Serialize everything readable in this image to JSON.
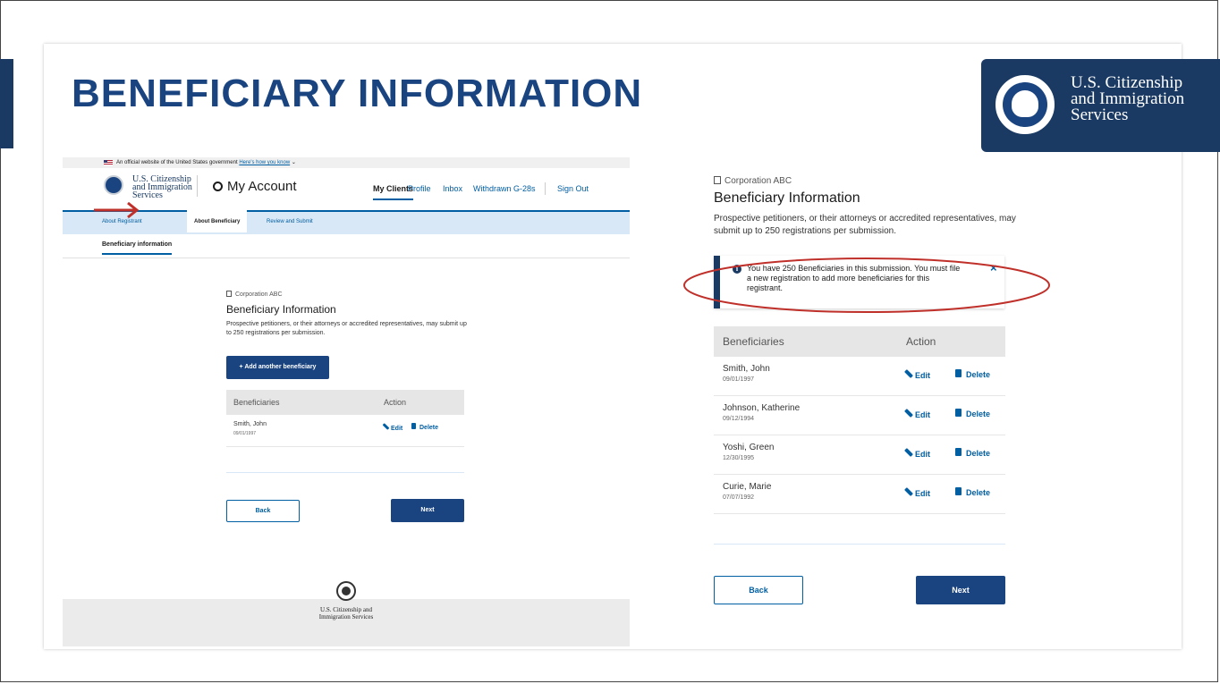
{
  "slide": {
    "title": "BENEFICIARY INFORMATION",
    "logo_lines": [
      "U.S. Citizenship",
      "and Immigration",
      "Services"
    ]
  },
  "left": {
    "gov_banner": "An official website of the United States government",
    "gov_banner_link": "Here's how you know",
    "header_logo_lines": [
      "U.S. Citizenship",
      "and Immigration",
      "Services"
    ],
    "my_account": "My Account",
    "nav": [
      "My Clients",
      "Profile",
      "Inbox",
      "Withdrawn G-28s",
      "Sign Out"
    ],
    "tabs": [
      "About Registrant",
      "About Beneficiary",
      "Review and Submit"
    ],
    "section_link": "Beneficiary information",
    "company": "Corporation ABC",
    "heading": "Beneficiary Information",
    "description": "Prospective petitioners, or their attorneys or accredited representatives, may submit up to 250 registrations per submission.",
    "add_button": "+ Add another beneficiary",
    "table": {
      "headers": [
        "Beneficiaries",
        "Action"
      ],
      "rows": [
        {
          "name": "Smith, John",
          "dob": "09/01/1997"
        }
      ]
    },
    "edit_label": "Edit",
    "delete_label": "Delete",
    "back": "Back",
    "next": "Next",
    "footer_lines": [
      "U.S. Citizenship and",
      "Immigration Services"
    ]
  },
  "right": {
    "company": "Corporation ABC",
    "heading": "Beneficiary Information",
    "description": "Prospective petitioners, or their attorneys or accredited representatives, may submit up to 250 registrations per submission.",
    "alert": "You have 250 Beneficiaries in this submission. You must file a new registration to add more beneficiaries for this registrant.",
    "alert_close": "×",
    "table": {
      "headers": [
        "Beneficiaries",
        "Action"
      ],
      "rows": [
        {
          "name": "Smith, John",
          "dob": "09/01/1997"
        },
        {
          "name": "Johnson, Katherine",
          "dob": "09/12/1994"
        },
        {
          "name": "Yoshi, Green",
          "dob": "12/30/1995"
        },
        {
          "name": "Curie, Marie",
          "dob": "07/07/1992"
        }
      ]
    },
    "edit_label": "Edit",
    "delete_label": "Delete",
    "back": "Back",
    "next": "Next"
  },
  "colors": {
    "brand_navy": "#1a3a63",
    "primary_blue": "#1a4480",
    "link_blue": "#005ea2",
    "annotation_red": "#c0302a"
  }
}
